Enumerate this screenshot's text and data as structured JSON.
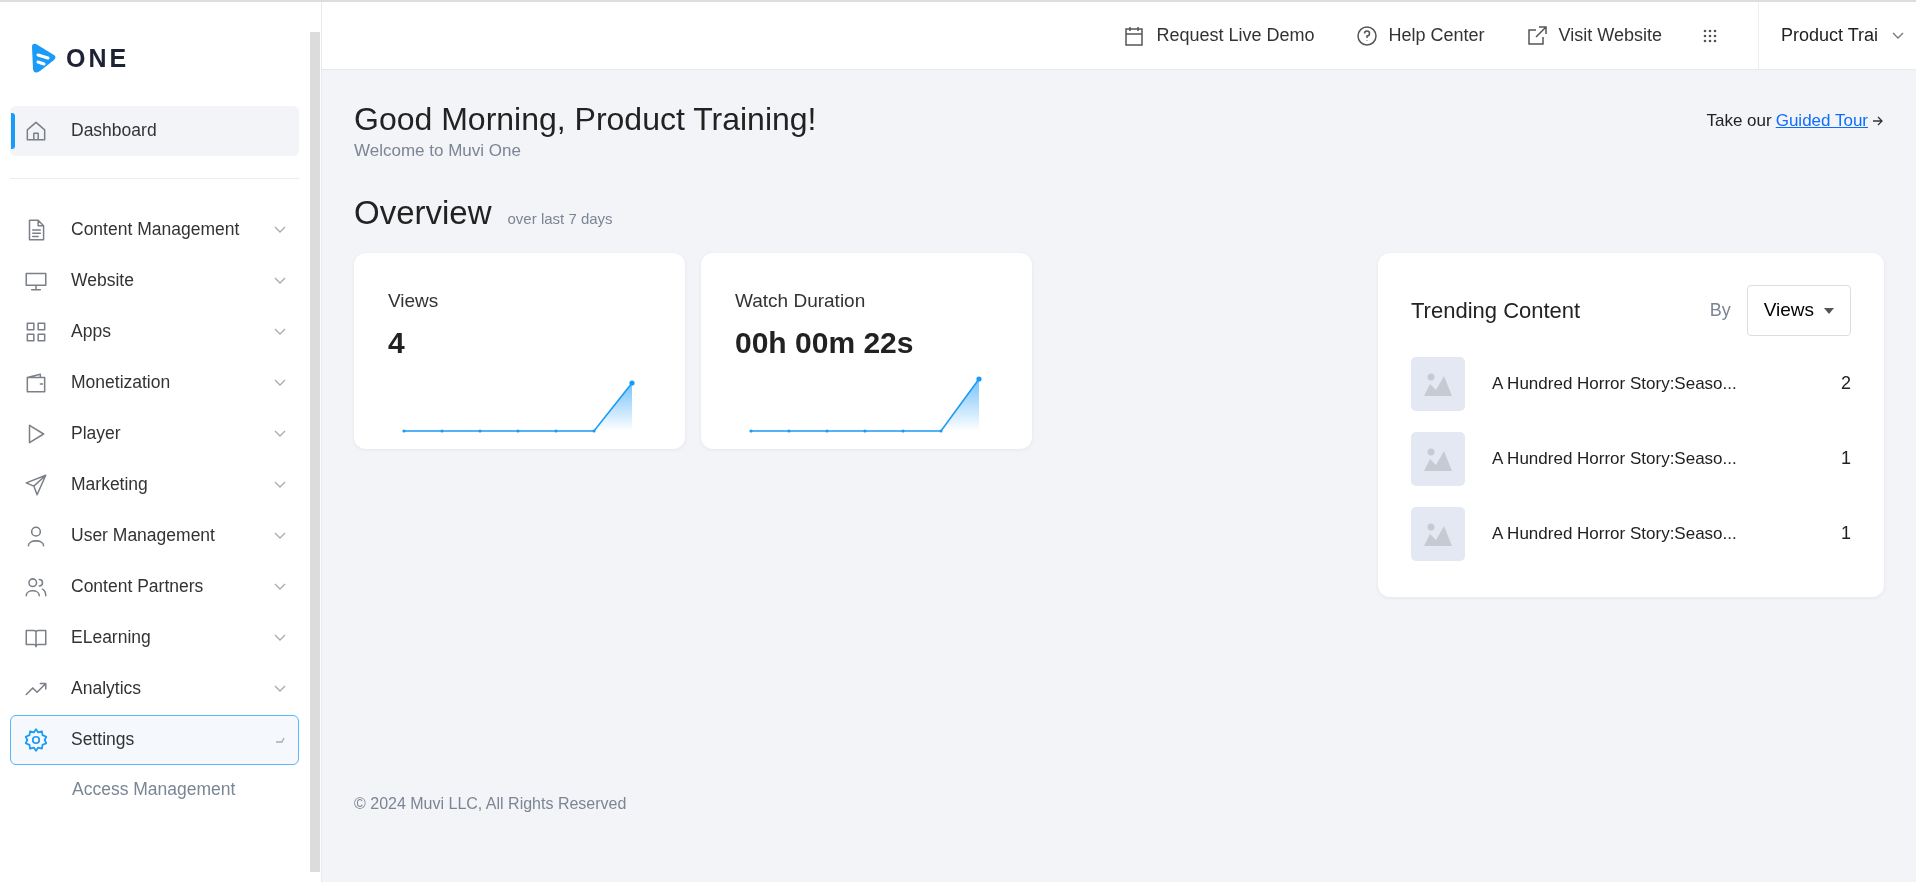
{
  "logo": {
    "text": "ONE"
  },
  "topbar": {
    "links": [
      {
        "label": "Request Live Demo"
      },
      {
        "label": "Help Center"
      },
      {
        "label": "Visit Website"
      }
    ],
    "user": "Product Trai"
  },
  "sidebar": {
    "items": [
      {
        "label": "Dashboard",
        "selected": true,
        "expanded": false
      },
      {
        "label": "Content Management",
        "selected": false,
        "expanded": false
      },
      {
        "label": "Website",
        "selected": false,
        "expanded": false
      },
      {
        "label": "Apps",
        "selected": false,
        "expanded": false
      },
      {
        "label": "Monetization",
        "selected": false,
        "expanded": false
      },
      {
        "label": "Player",
        "selected": false,
        "expanded": false
      },
      {
        "label": "Marketing",
        "selected": false,
        "expanded": false
      },
      {
        "label": "User Management",
        "selected": false,
        "expanded": false
      },
      {
        "label": "Content Partners",
        "selected": false,
        "expanded": false
      },
      {
        "label": "ELearning",
        "selected": false,
        "expanded": false
      },
      {
        "label": "Analytics",
        "selected": false,
        "expanded": false
      },
      {
        "label": "Settings",
        "selected": false,
        "expanded": true,
        "children": [
          {
            "label": "Access Management"
          }
        ]
      }
    ]
  },
  "header": {
    "greeting": "Good Morning, Product Training!",
    "subtitle": "Welcome to Muvi One",
    "tour_prefix": "Take our",
    "tour_link": "Guided Tour"
  },
  "overview": {
    "title": "Overview",
    "period": "over last 7 days",
    "metrics": [
      {
        "label": "Views",
        "value": "4"
      },
      {
        "label": "Watch Duration",
        "value": "00h 00m 22s"
      }
    ]
  },
  "trending": {
    "title": "Trending Content",
    "by_label": "By",
    "sort": "Views",
    "items": [
      {
        "title": "A Hundred Horror Story:Seaso...",
        "count": "2"
      },
      {
        "title": "A Hundred Horror Story:Seaso...",
        "count": "1"
      },
      {
        "title": "A Hundred Horror Story:Seaso...",
        "count": "1"
      }
    ]
  },
  "footer": "© 2024 Muvi LLC, All Rights Reserved"
}
